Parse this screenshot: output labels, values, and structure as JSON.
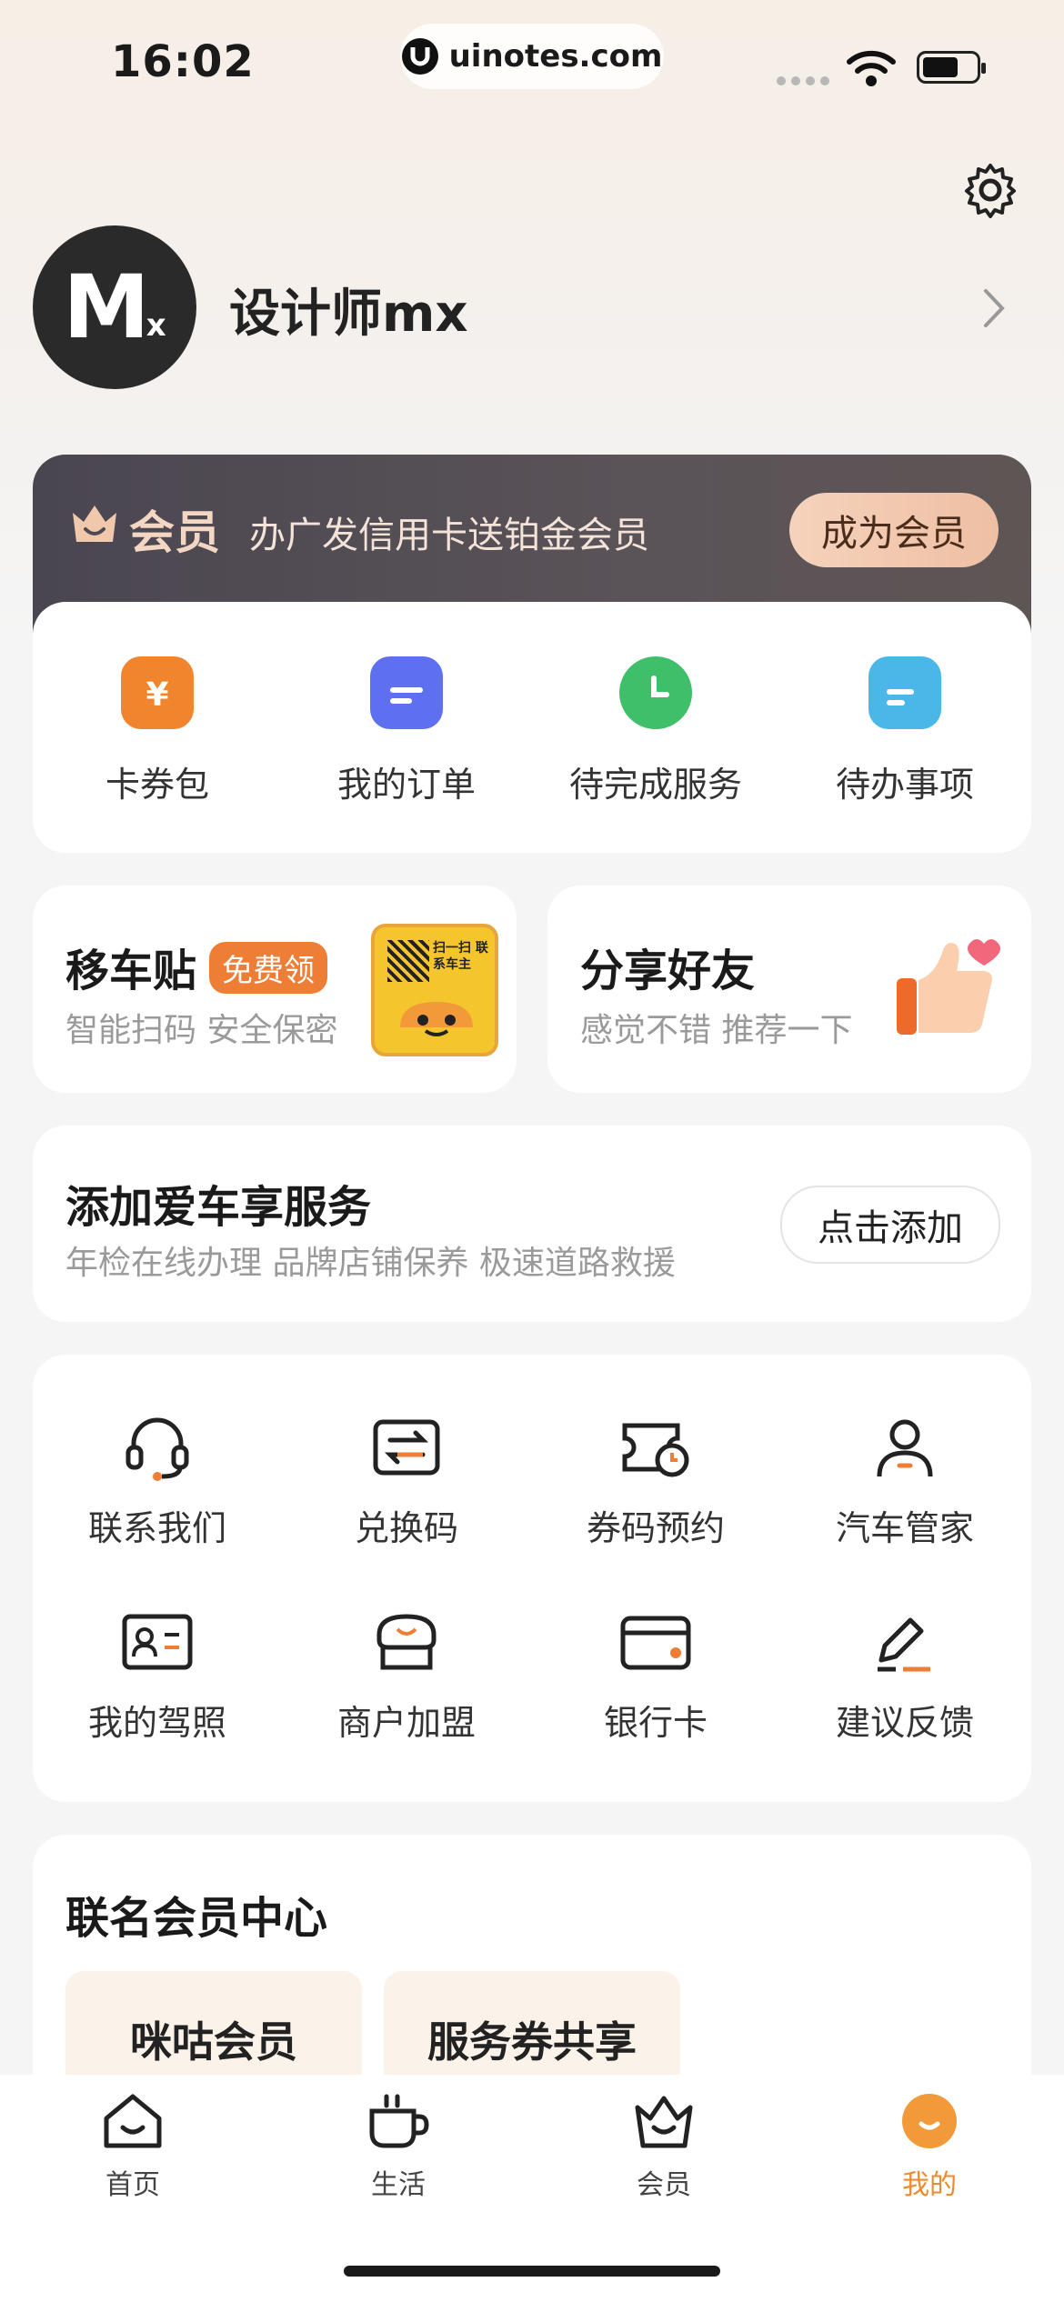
{
  "status_bar": {
    "time": "16:02",
    "url": "uinotes.com"
  },
  "profile": {
    "avatar_text": "M",
    "avatar_sub": "x",
    "name": "设计师mx"
  },
  "member": {
    "title": "会员",
    "promo": "办广发信用卡送铂金会员",
    "button": "成为会员"
  },
  "quick_actions": [
    {
      "label": "卡券包",
      "icon": "coupon-wallet-icon",
      "color": "#f0852d"
    },
    {
      "label": "我的订单",
      "icon": "order-icon",
      "color": "#5e6ff0"
    },
    {
      "label": "待完成服务",
      "icon": "clock-icon",
      "color": "#3fbf6a"
    },
    {
      "label": "待办事项",
      "icon": "todo-icon",
      "color": "#4ab7e8"
    }
  ],
  "promo_cards": {
    "move_car": {
      "title": "移车贴",
      "badge": "免费领",
      "subtitle": "智能扫码 安全保密",
      "sticker_text": "扫一扫 联系车主"
    },
    "share": {
      "title": "分享好友",
      "subtitle": "感觉不错 推荐一下"
    }
  },
  "car_service": {
    "title": "添加爱车享服务",
    "subtitle": "年检在线办理 品牌店铺保养 极速道路救援",
    "button": "点击添加"
  },
  "service_grid": [
    {
      "label": "联系我们",
      "icon": "headset-icon"
    },
    {
      "label": "兑换码",
      "icon": "exchange-code-icon"
    },
    {
      "label": "券码预约",
      "icon": "coupon-booking-icon"
    },
    {
      "label": "汽车管家",
      "icon": "car-butler-icon"
    },
    {
      "label": "我的驾照",
      "icon": "license-icon"
    },
    {
      "label": "商户加盟",
      "icon": "merchant-icon"
    },
    {
      "label": "银行卡",
      "icon": "bank-card-icon"
    },
    {
      "label": "建议反馈",
      "icon": "feedback-icon"
    }
  ],
  "joint_member": {
    "title": "联名会员中心",
    "chips": [
      "咪咕会员",
      "服务券共享"
    ]
  },
  "tabs": [
    {
      "label": "首页",
      "icon": "home-icon"
    },
    {
      "label": "生活",
      "icon": "life-cup-icon"
    },
    {
      "label": "会员",
      "icon": "crown-icon"
    },
    {
      "label": "我的",
      "icon": "profile-icon",
      "active": true
    }
  ],
  "colors": {
    "accent": "#ee8a2f",
    "member_bg": "#4f4a52",
    "badge": "#ee7d35"
  }
}
